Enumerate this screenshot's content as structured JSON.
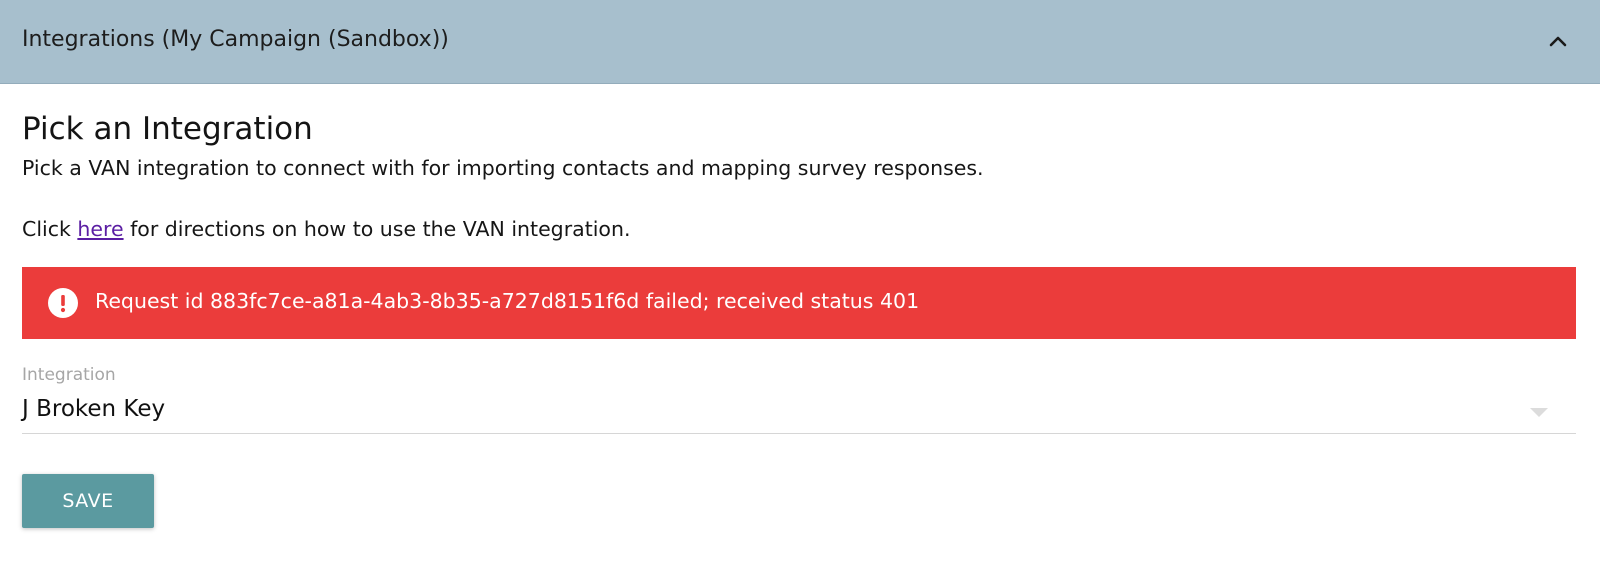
{
  "panel": {
    "title": "Integrations (My Campaign (Sandbox))",
    "collapse_icon": "chevron-up-icon",
    "header_color": "#a7bfcd"
  },
  "main": {
    "heading": "Pick an Integration",
    "description": "Pick a VAN integration to connect with for importing contacts and mapping survey responses.",
    "directions": {
      "prefix": "Click ",
      "link_text": "here",
      "suffix": " for directions on how to use the VAN integration.",
      "link_color": "#5b1ea3"
    }
  },
  "error": {
    "icon": "alert-circle-icon",
    "message": "Request id 883fc7ce-a81a-4ab3-8b35-a727d8151f6d failed; received status 401",
    "color": "#eb3c3b"
  },
  "integration_field": {
    "label": "Integration",
    "selected_value": "J Broken Key",
    "arrow_icon": "dropdown-arrow-icon"
  },
  "actions": {
    "save_label": "SAVE",
    "save_color": "#5b9aa0"
  }
}
